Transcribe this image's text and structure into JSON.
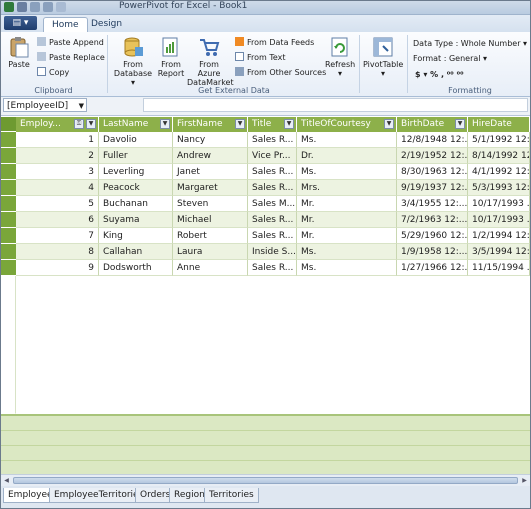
{
  "window": {
    "title": "PowerPivot for Excel - Book1"
  },
  "tabs": {
    "app_button": "▤ ▾",
    "home": "Home",
    "design": "Design"
  },
  "ribbon": {
    "clipboard": {
      "paste": "Paste",
      "paste_append": "Paste Append",
      "paste_replace": "Paste Replace",
      "copy": "Copy",
      "label": "Clipboard"
    },
    "external": {
      "from_database": "From Database ▾",
      "from_report": "From Report",
      "from_azure": "From Azure DataMarket",
      "from_data_feeds": "From Data Feeds",
      "from_text": "From Text",
      "from_other": "From Other Sources",
      "refresh": "Refresh ▾",
      "label": "Get External Data"
    },
    "pivot": {
      "pivottable": "PivotTable ▾"
    },
    "formatting": {
      "data_type": "Data Type : Whole Number ▾",
      "format": "Format : General ▾",
      "symbols": "$ ▾  %  ,  ⁰⁰ ⁰⁰",
      "label": "Formatting"
    }
  },
  "formula_bar": {
    "name_box": "[EmployeeID]"
  },
  "table": {
    "columns": [
      "Employ...",
      "LastName",
      "FirstName",
      "Title",
      "TitleOfCourtesy",
      "BirthDate",
      "HireDate"
    ],
    "rows": [
      [
        "1",
        "Davolio",
        "Nancy",
        "Sales R...",
        "Ms.",
        "12/8/1948 12:...",
        "5/1/1992 12:..."
      ],
      [
        "2",
        "Fuller",
        "Andrew",
        "Vice Pr...",
        "Dr.",
        "2/19/1952 12:...",
        "8/14/1992 12..."
      ],
      [
        "3",
        "Leverling",
        "Janet",
        "Sales R...",
        "Ms.",
        "8/30/1963 12:...",
        "4/1/1992 12:..."
      ],
      [
        "4",
        "Peacock",
        "Margaret",
        "Sales R...",
        "Mrs.",
        "9/19/1937 12:...",
        "5/3/1993 12:..."
      ],
      [
        "5",
        "Buchanan",
        "Steven",
        "Sales M...",
        "Mr.",
        "3/4/1955 12:...",
        "10/17/1993 ..."
      ],
      [
        "6",
        "Suyama",
        "Michael",
        "Sales R...",
        "Mr.",
        "7/2/1963 12:...",
        "10/17/1993 ..."
      ],
      [
        "7",
        "King",
        "Robert",
        "Sales R...",
        "Mr.",
        "5/29/1960 12:...",
        "1/2/1994 12:..."
      ],
      [
        "8",
        "Callahan",
        "Laura",
        "Inside S...",
        "Ms.",
        "1/9/1958 12:...",
        "3/5/1994 12:..."
      ],
      [
        "9",
        "Dodsworth",
        "Anne",
        "Sales R...",
        "Ms.",
        "1/27/1966 12:...",
        "11/15/1994 ..."
      ]
    ]
  },
  "sheet_tabs": [
    "Employees",
    "EmployeeTerritories",
    "Orders",
    "Region",
    "Territories"
  ],
  "colors": {
    "header_green": "#8db04a",
    "row_alt": "#edf3e1",
    "selector": "#7aa63a",
    "ribbon_blue": "#d5e1ef"
  }
}
